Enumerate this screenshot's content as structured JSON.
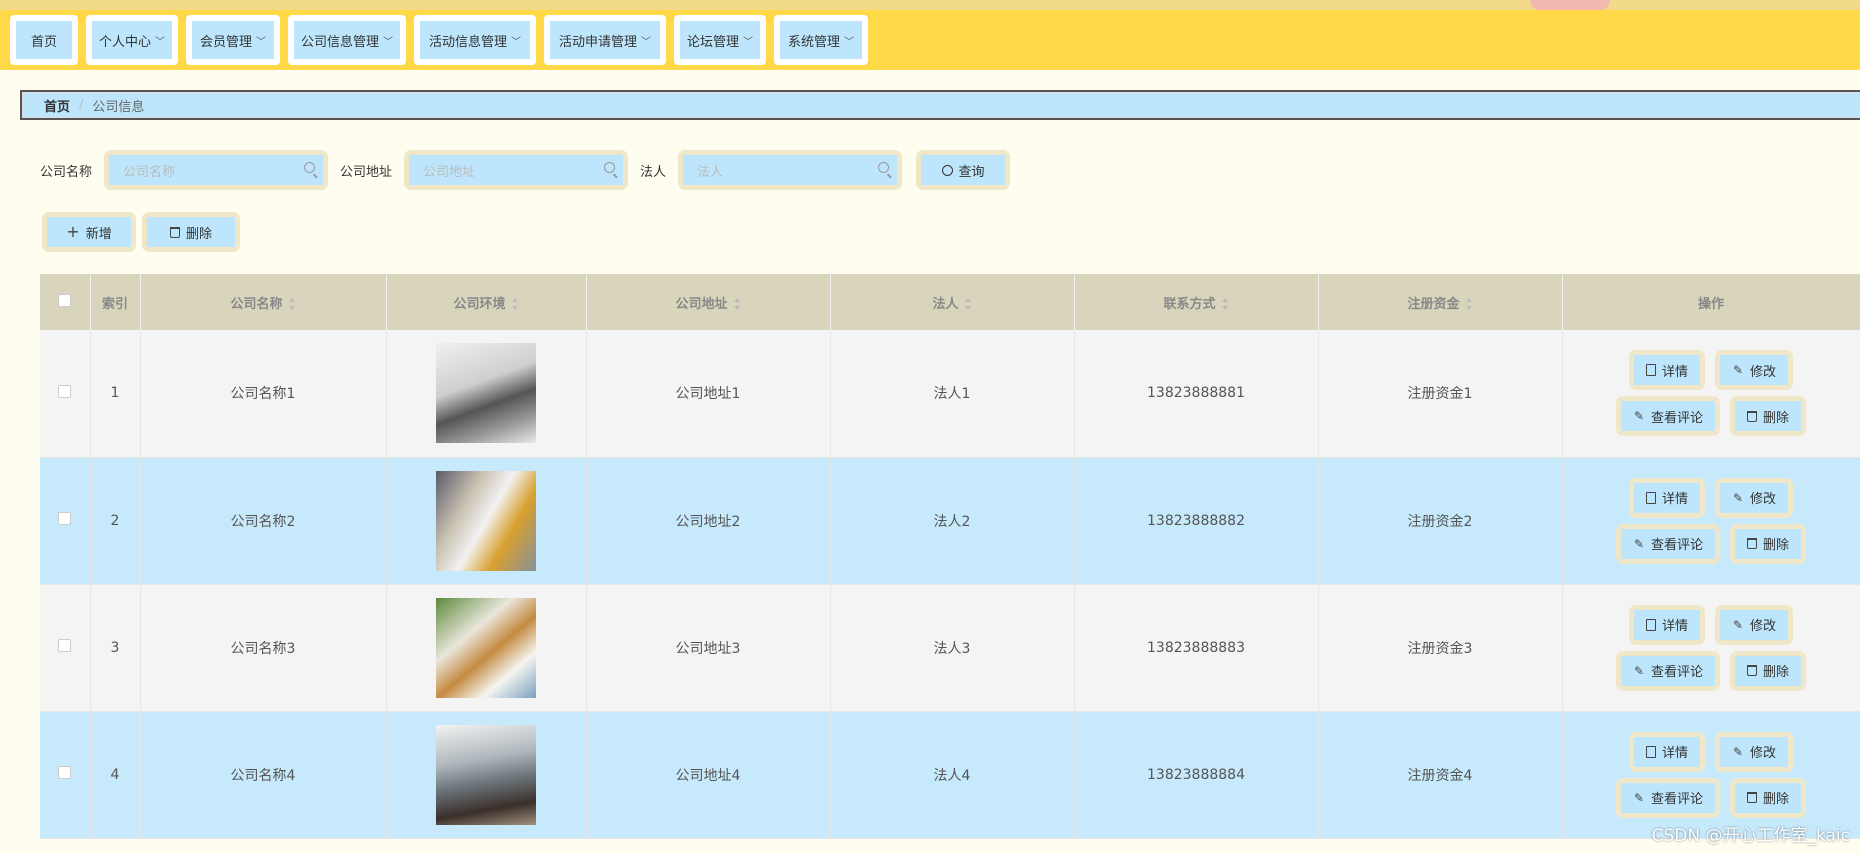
{
  "nav": {
    "items": [
      {
        "label": "首页",
        "dropdown": false
      },
      {
        "label": "个人中心",
        "dropdown": true
      },
      {
        "label": "会员管理",
        "dropdown": true
      },
      {
        "label": "公司信息管理",
        "dropdown": true
      },
      {
        "label": "活动信息管理",
        "dropdown": true
      },
      {
        "label": "活动申请管理",
        "dropdown": true
      },
      {
        "label": "论坛管理",
        "dropdown": true
      },
      {
        "label": "系统管理",
        "dropdown": true
      }
    ]
  },
  "breadcrumb": {
    "home": "首页",
    "separator": "/",
    "current": "公司信息"
  },
  "search": {
    "company_name_label": "公司名称",
    "company_name_placeholder": "公司名称",
    "address_label": "公司地址",
    "address_placeholder": "公司地址",
    "legal_label": "法人",
    "legal_placeholder": "法人",
    "query_label": "查询"
  },
  "actions": {
    "add_label": "新增",
    "delete_label": "删除"
  },
  "table": {
    "columns": [
      "索引",
      "公司名称",
      "公司环境",
      "公司地址",
      "法人",
      "联系方式",
      "注册资金",
      "操作"
    ],
    "rows": [
      {
        "index": "1",
        "name": "公司名称1",
        "address": "公司地址1",
        "legal": "法人1",
        "phone": "13823888881",
        "capital": "注册资金1"
      },
      {
        "index": "2",
        "name": "公司名称2",
        "address": "公司地址2",
        "legal": "法人2",
        "phone": "13823888882",
        "capital": "注册资金2"
      },
      {
        "index": "3",
        "name": "公司名称3",
        "address": "公司地址3",
        "legal": "法人3",
        "phone": "13823888883",
        "capital": "注册资金3"
      },
      {
        "index": "4",
        "name": "公司名称4",
        "address": "公司地址4",
        "legal": "法人4",
        "phone": "13823888884",
        "capital": "注册资金4"
      }
    ],
    "row_actions": {
      "detail": "详情",
      "edit": "修改",
      "comments": "查看评论",
      "delete": "删除"
    }
  },
  "watermark": "CSDN @开心工作室_kaic",
  "colors": {
    "navbar": "#ffd947",
    "accent_blue": "#bde6fc",
    "button_frame": "#efe7c7",
    "header_bg": "#d9d5bd",
    "even_row": "#c6e9fc"
  }
}
